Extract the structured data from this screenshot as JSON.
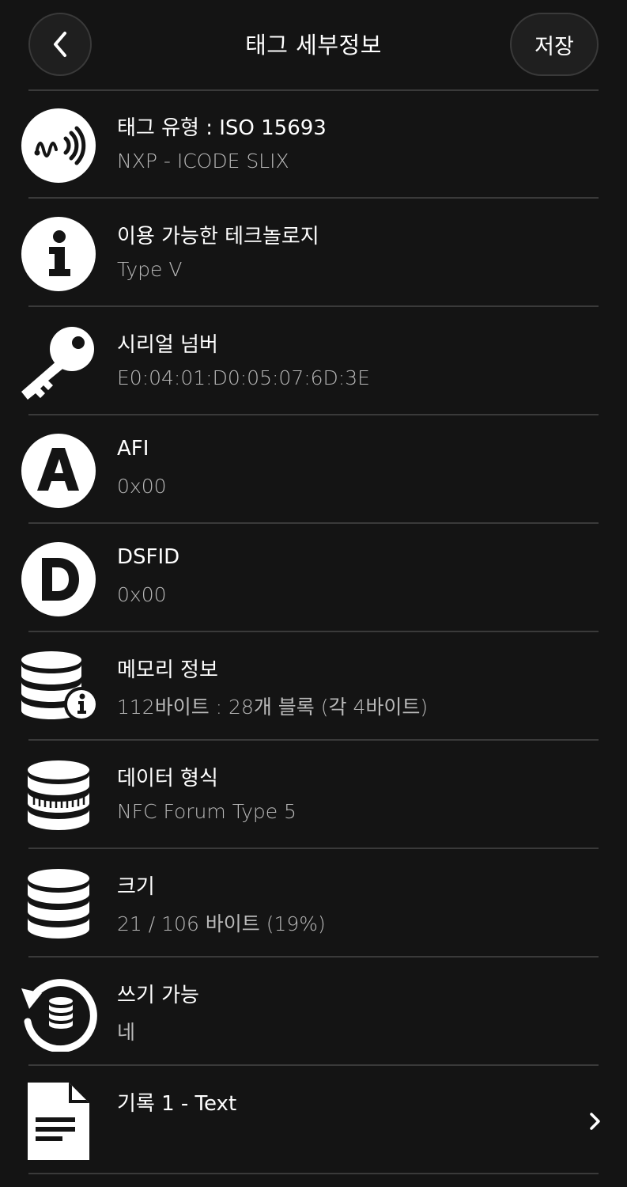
{
  "header": {
    "title": "태그 세부정보",
    "save_label": "저장"
  },
  "rows": [
    {
      "icon": "nfc-tag-icon",
      "label": "태그 유형 : ISO 15693",
      "value": "NXP - ICODE SLIX"
    },
    {
      "icon": "info-icon",
      "label": "이용 가능한 테크놀로지",
      "value": "Type V"
    },
    {
      "icon": "key-icon",
      "label": "시리얼 넘버",
      "value": "E0:04:01:D0:05:07:6D:3E"
    },
    {
      "icon": "letter-a-icon",
      "label": "AFI",
      "value": "0x00"
    },
    {
      "icon": "letter-d-icon",
      "label": "DSFID",
      "value": "0x00"
    },
    {
      "icon": "database-info-icon",
      "label": "메모리 정보",
      "value": "112바이트 : 28개 블록 (각 4바이트)"
    },
    {
      "icon": "database-format-icon",
      "label": "데이터 형식",
      "value": "NFC Forum Type 5"
    },
    {
      "icon": "database-icon",
      "label": "크기",
      "value": "21 / 106 바이트 (19%)"
    },
    {
      "icon": "database-rewrite-icon",
      "label": "쓰기 가능",
      "value": "네"
    },
    {
      "icon": "document-icon",
      "label": "기록 1 - Text",
      "value": ""
    }
  ],
  "colors": {
    "background": "#141414",
    "divider": "#3a3a3a",
    "text_primary": "#ffffff",
    "text_secondary": "#b9b9b9"
  }
}
